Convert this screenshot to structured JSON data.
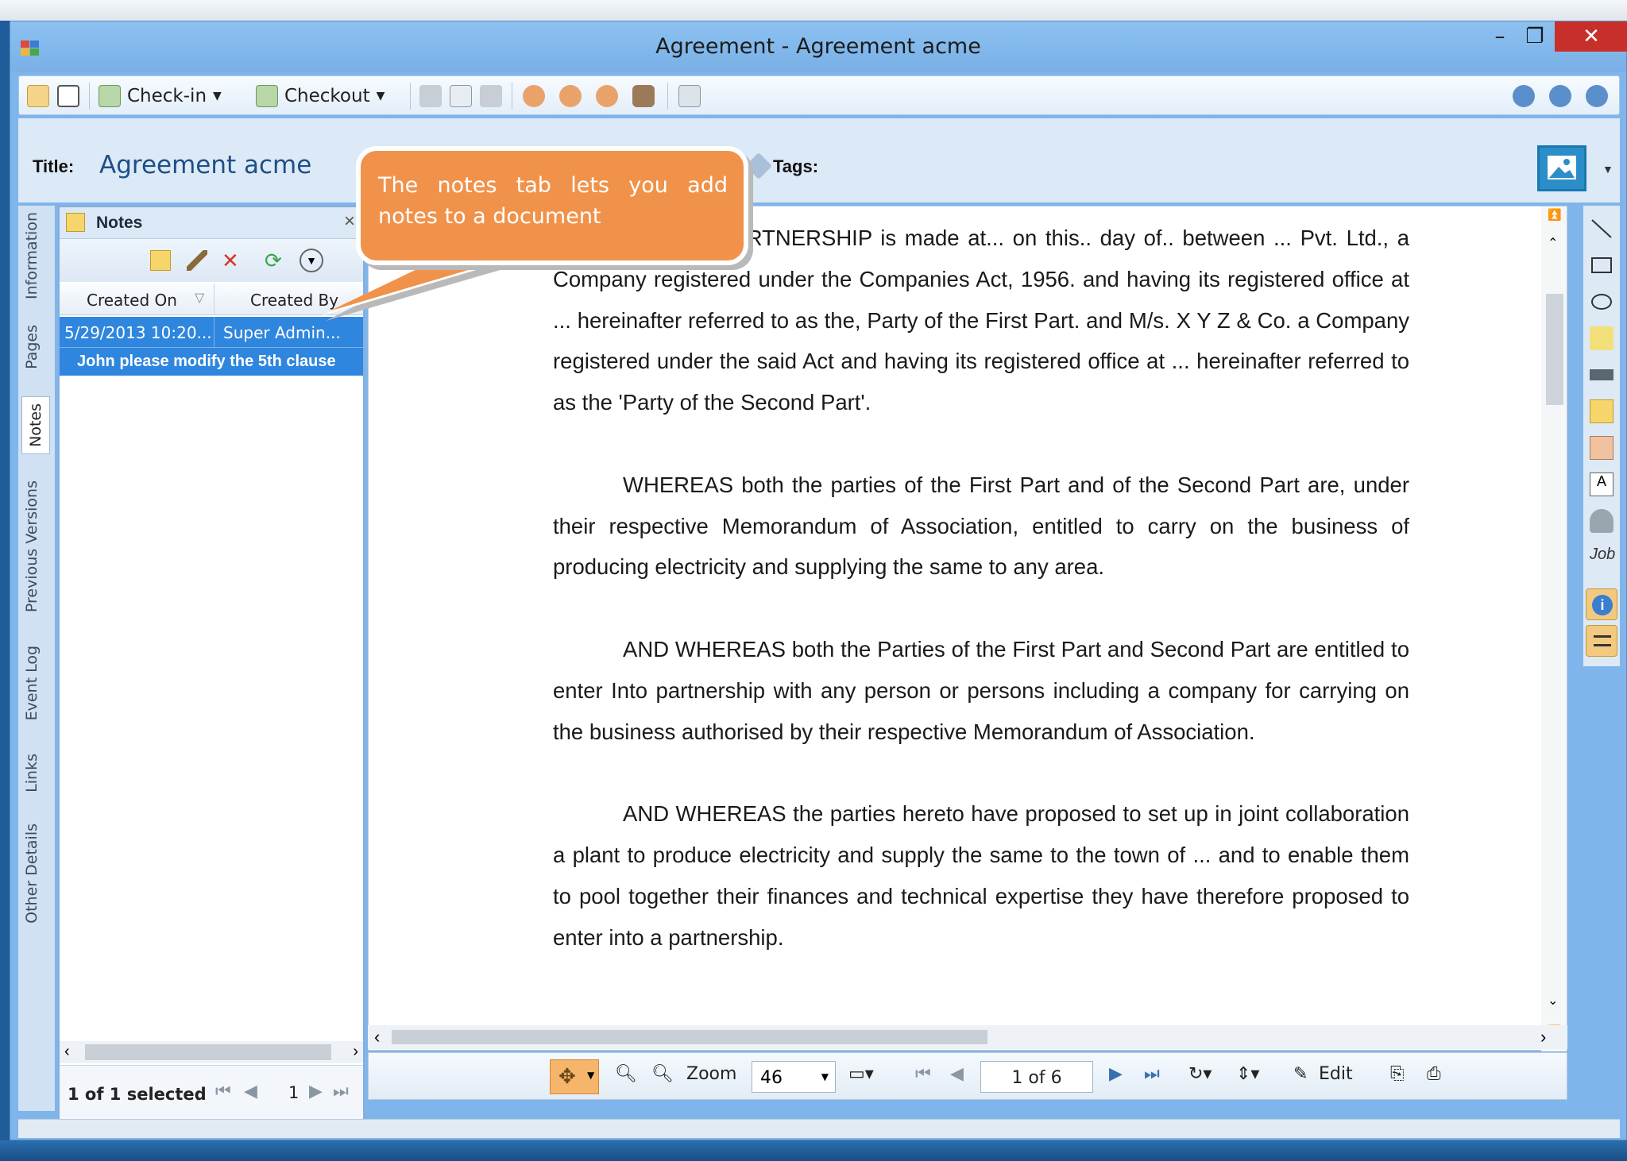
{
  "window": {
    "title": "Agreement - Agreement acme",
    "minimize": "–",
    "maximize": "❐",
    "close": "✕"
  },
  "toolbar": {
    "checkin": "Check-in",
    "checkout": "Checkout"
  },
  "doc_header": {
    "title_label": "Title:",
    "title_value": "Agreement acme",
    "tags_label": "Tags:"
  },
  "side_tabs": [
    "Information",
    "Pages",
    "Notes",
    "Previous Versions",
    "Event Log",
    "Links",
    "Other Details"
  ],
  "notes_panel": {
    "title": "Notes",
    "close": "×",
    "columns": [
      "Created On",
      "Created By"
    ],
    "rows": [
      {
        "created_on": "5/29/2013 10:20...",
        "created_by": "Super Admin...",
        "text": "John please modify the 5th clause"
      }
    ],
    "selection_status": "1 of 1 selected",
    "page": "1"
  },
  "callout": {
    "text": "The notes tab lets you add notes to a document"
  },
  "document": {
    "paragraphs": [
      "THIS DEED OF PARTNERSHIP is made at... on this.. day of.. between ... Pvt. Ltd., a Company registered under the Companies Act, 1956. and having its registered office at ... hereinafter referred to as the, Party of the First Part. and M/s. X Y Z & Co. a Company registered under the said Act and having its registered office at ... hereinafter referred to as the 'Party of the Second Part'.",
      "WHEREAS both the parties of the First Part and of the Second Part are, under their respective Memorandum of Association, entitled to carry on the business of producing electricity and supplying the same to any area.",
      "AND WHEREAS both the Parties of the First Part and Second Part are entitled to enter Into partnership with any person or persons including a company for carrying on the business authorised by their respective Memorandum of Association.",
      "AND WHEREAS the parties hereto have proposed to set up in joint collaboration a plant to produce electricity and supply the same to the town of ... and to enable them to pool together their finances and technical expertise they have therefore proposed to enter into a partnership."
    ]
  },
  "viewer_bar": {
    "zoom_label": "Zoom",
    "zoom_value": "46",
    "page_display": "1 of 6",
    "edit_label": "Edit"
  }
}
